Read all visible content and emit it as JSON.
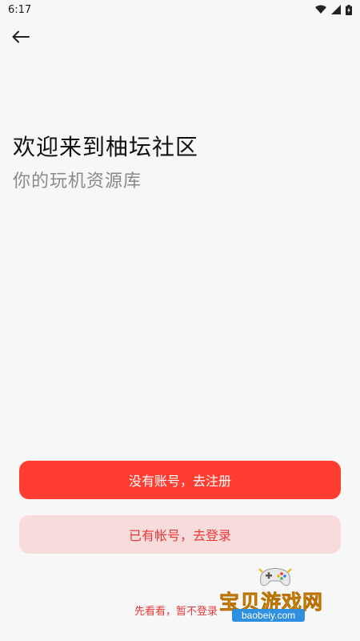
{
  "status_bar": {
    "time": "6:17"
  },
  "header": {
    "back_icon": "arrow-left-icon"
  },
  "welcome": {
    "title": "欢迎来到柚坛社区",
    "subtitle": "你的玩机资源库"
  },
  "actions": {
    "register_label": "没有账号，去注册",
    "login_label": "已有帐号，去登录",
    "skip_label": "先看看，暂不登录"
  },
  "watermark": {
    "text": "宝贝游戏网",
    "url": "baobeiy.com"
  },
  "colors": {
    "primary": "#ff3d30",
    "secondary_bg": "#f8dcdc",
    "accent_text": "#e8393a",
    "background": "#f7f7f7"
  }
}
